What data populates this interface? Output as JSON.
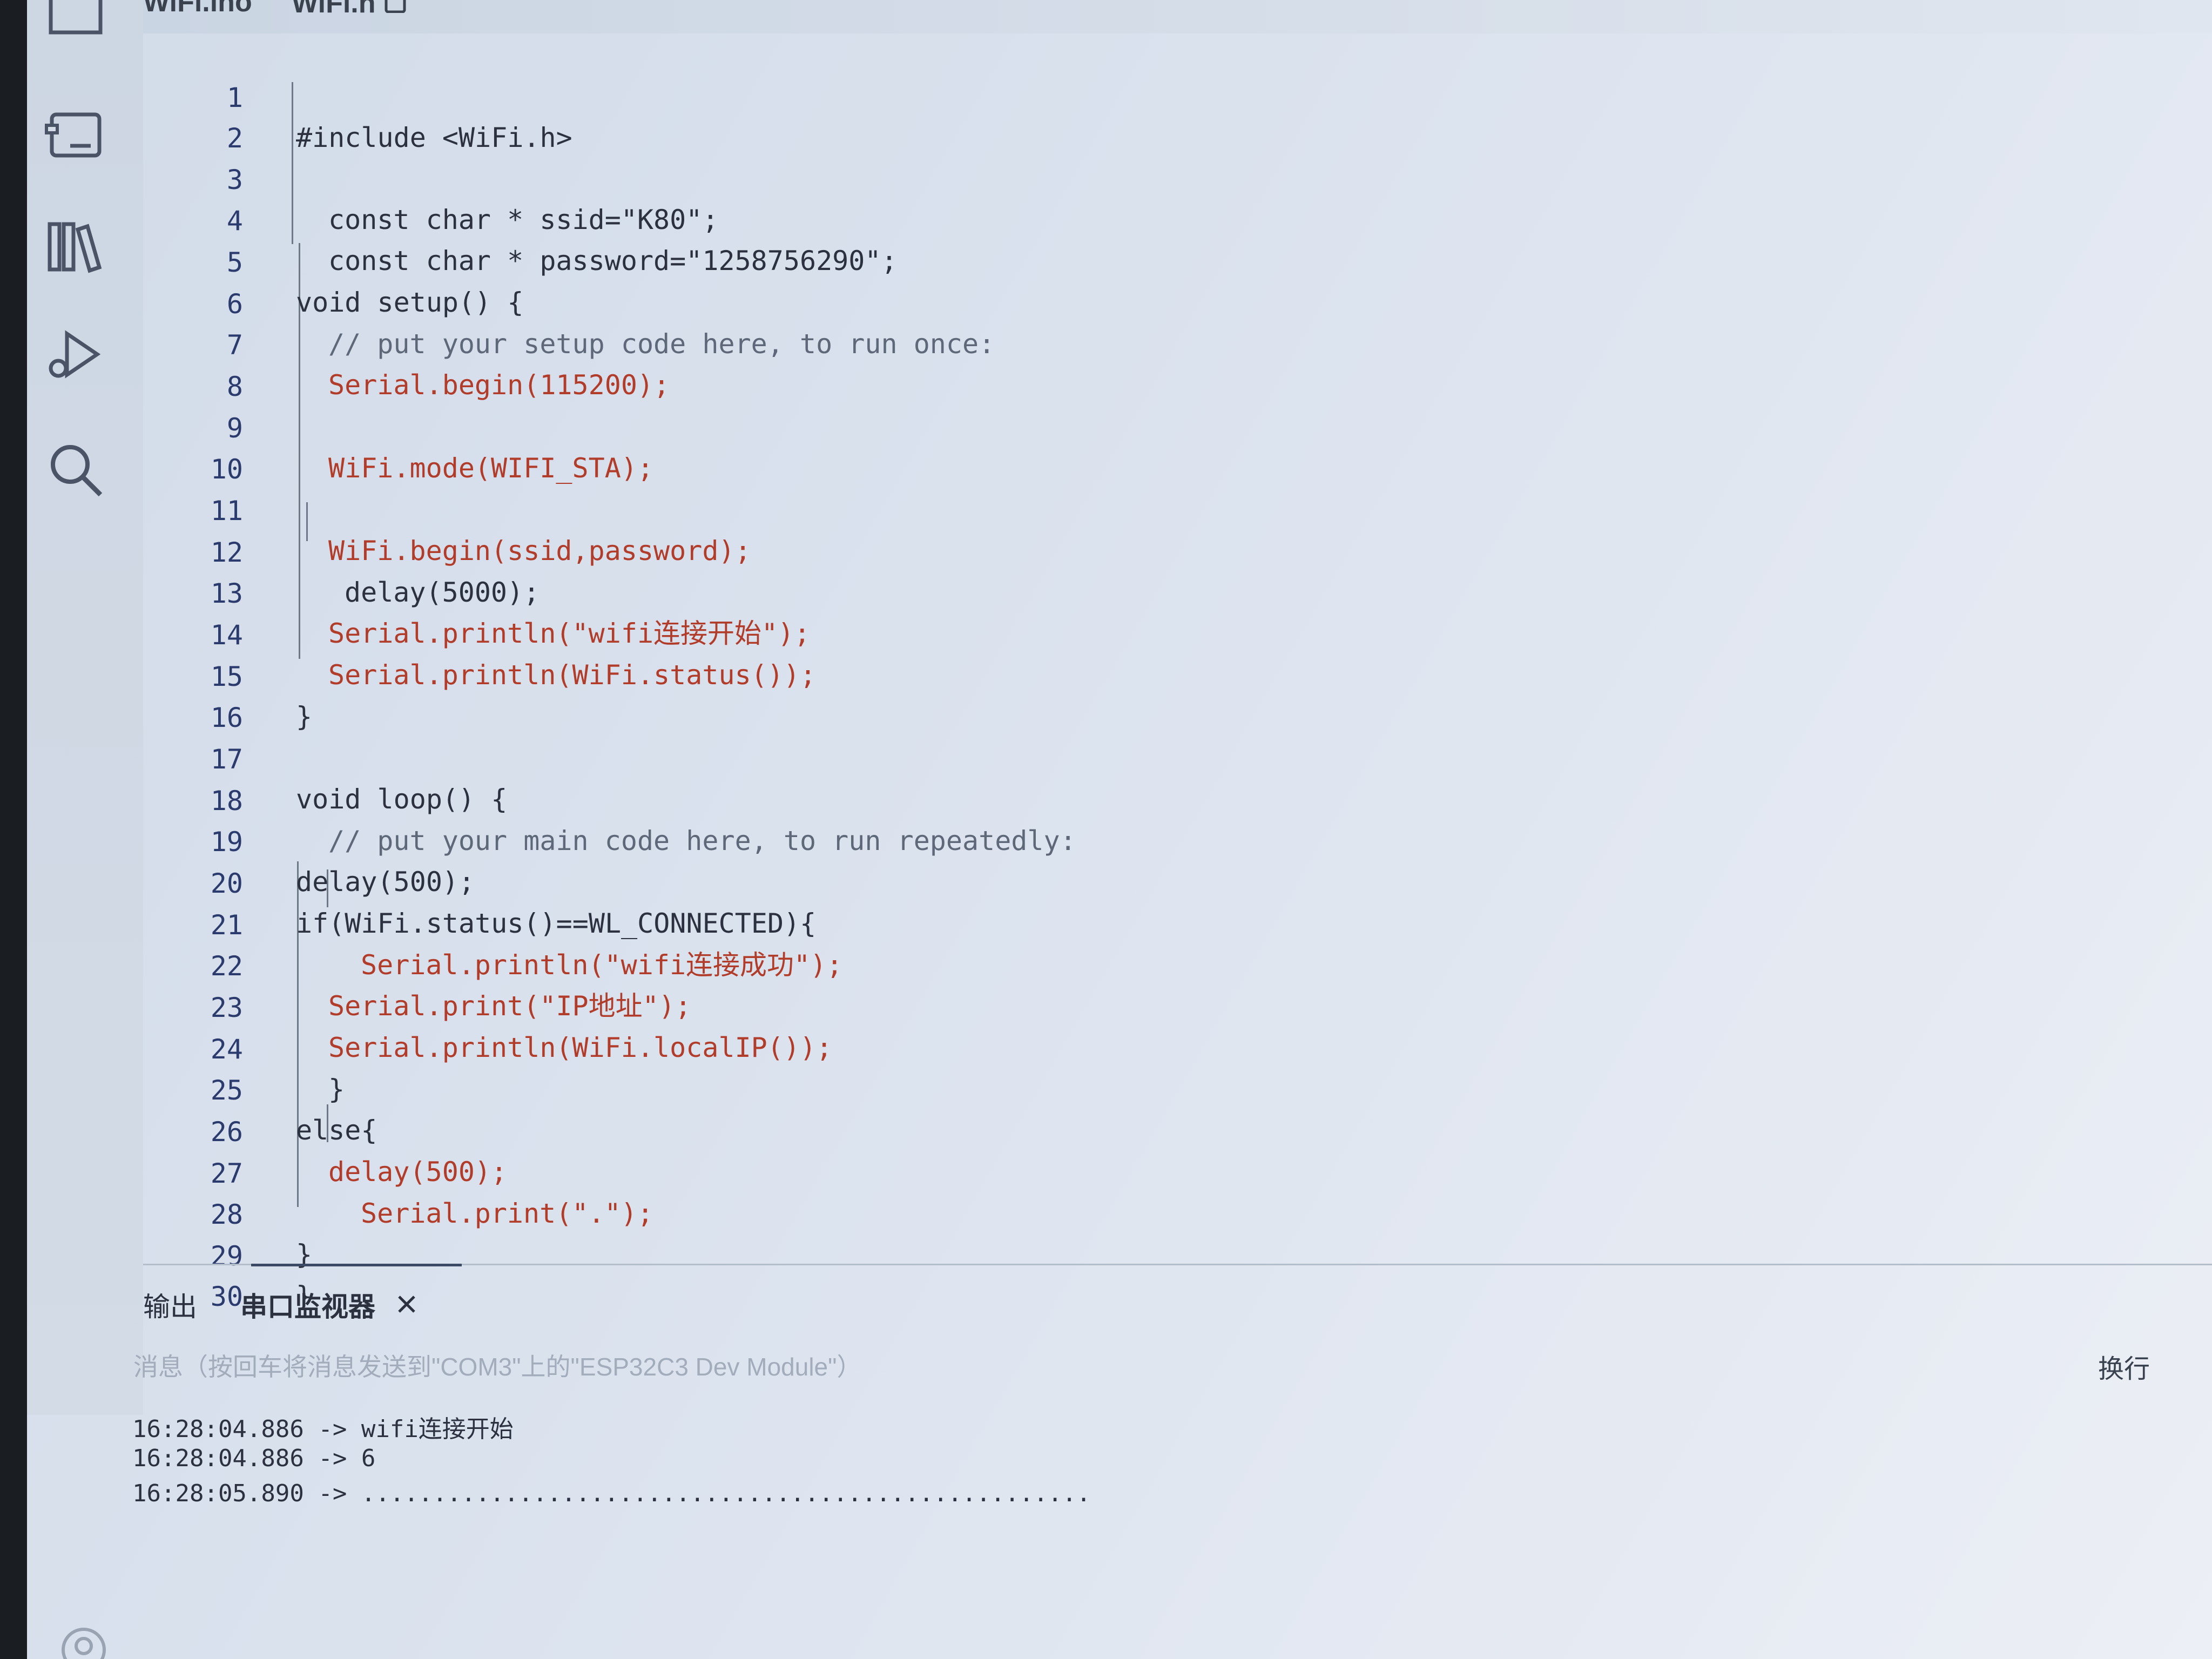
{
  "tabs": {
    "ino": "WiFi.ino",
    "h": "WiFi.h"
  },
  "activity": {
    "icons": [
      "folder-icon",
      "board-icon",
      "library-icon",
      "debug-icon",
      "search-icon"
    ]
  },
  "editor": {
    "lines": [
      {
        "n": "1",
        "code": "#include <WiFi.h>"
      },
      {
        "n": "2",
        "code": ""
      },
      {
        "n": "3",
        "code": "const char * ssid=\"K80\";"
      },
      {
        "n": "4",
        "code": "const char * password=\"1258756290\";"
      },
      {
        "n": "5",
        "code": "void setup() {"
      },
      {
        "n": "6",
        "code": "// put your setup code here, to run once:"
      },
      {
        "n": "7",
        "code": "Serial.begin(115200);"
      },
      {
        "n": "8",
        "code": ""
      },
      {
        "n": "9",
        "code": "WiFi.mode(WIFI_STA);"
      },
      {
        "n": "10",
        "code": ""
      },
      {
        "n": "11",
        "code": "WiFi.begin(ssid,password);"
      },
      {
        "n": "12",
        "code": "delay(5000);"
      },
      {
        "n": "13",
        "code": "Serial.println(\"wifi连接开始\");"
      },
      {
        "n": "14",
        "code": "Serial.println(WiFi.status());"
      },
      {
        "n": "15",
        "code": "}"
      },
      {
        "n": "16",
        "code": ""
      },
      {
        "n": "17",
        "code": "void loop() {"
      },
      {
        "n": "18",
        "code": "// put your main code here, to run repeatedly:"
      },
      {
        "n": "19",
        "code": "delay(500);"
      },
      {
        "n": "20",
        "code": "if(WiFi.status()==WL_CONNECTED){"
      },
      {
        "n": "21",
        "code": "Serial.println(\"wifi连接成功\");"
      },
      {
        "n": "22",
        "code": "Serial.print(\"IP地址\");"
      },
      {
        "n": "23",
        "code": "Serial.println(WiFi.localIP());"
      },
      {
        "n": "24",
        "code": "}"
      },
      {
        "n": "25",
        "code": "else{"
      },
      {
        "n": "26",
        "code": "delay(500);"
      },
      {
        "n": "27",
        "code": "Serial.print(\".\");"
      },
      {
        "n": "28",
        "code": "}"
      },
      {
        "n": "29",
        "code": "}"
      },
      {
        "n": "30",
        "code": ""
      }
    ]
  },
  "panel": {
    "output_tab": "输出",
    "serial_tab": "串口监视器",
    "message_placeholder": "消息（按回车将消息发送到\"COM3\"上的\"ESP32C3 Dev Module\"）",
    "line_ending": "换行",
    "serial_lines": [
      "16:28:04.886 -> wifi连接开始",
      "16:28:04.886 -> 6",
      "16:28:05.890 -> ..................................................."
    ]
  }
}
